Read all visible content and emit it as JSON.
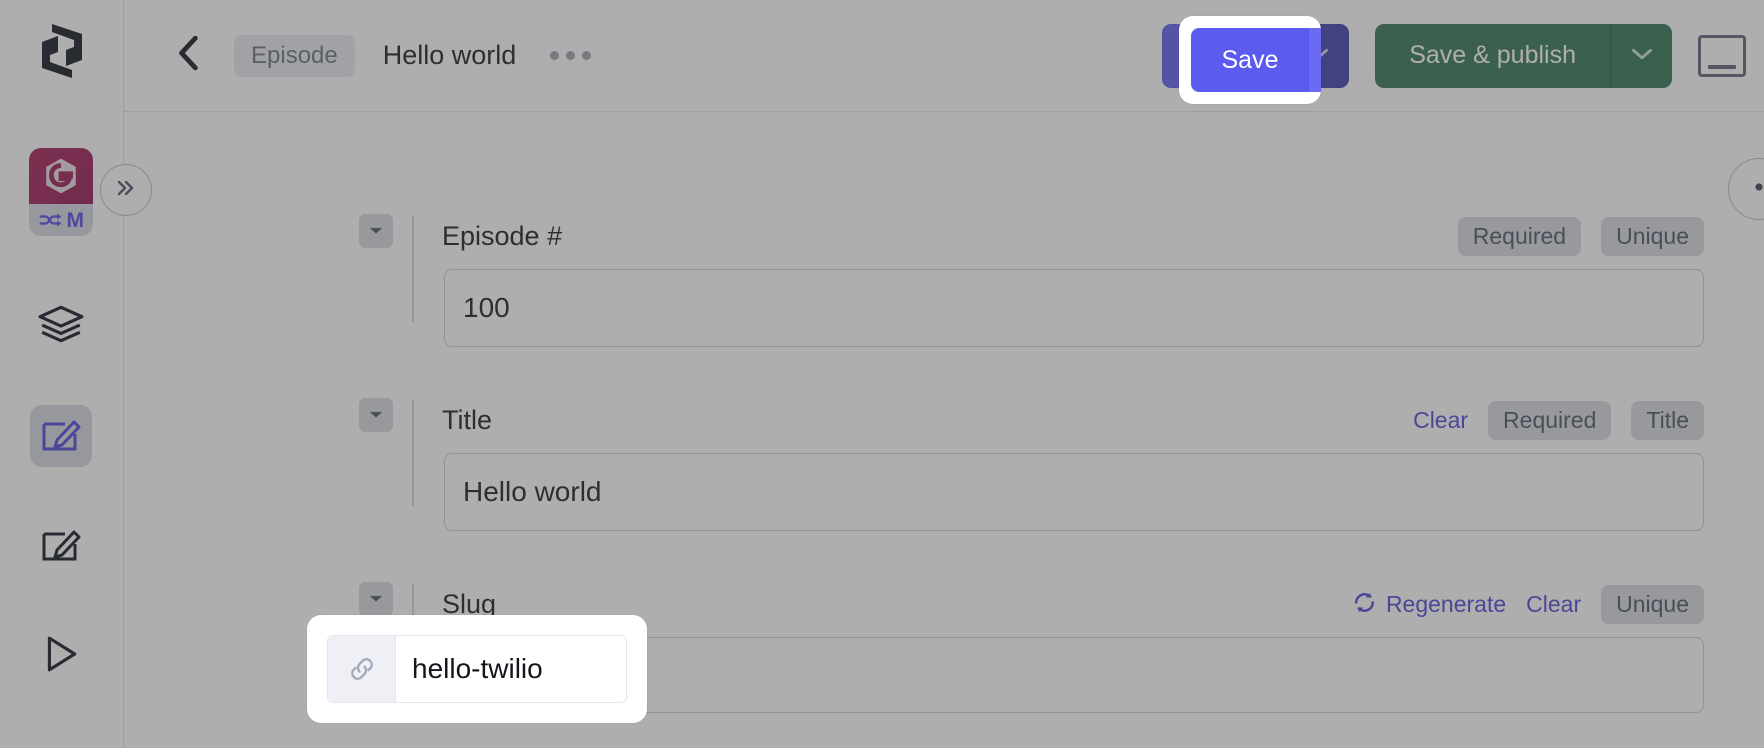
{
  "sidebar": {
    "logo_icon": "sanity-logo-icon",
    "project_badge": {
      "logo_icon": "g-hexagon-logo-icon",
      "sync_icon": "sync-arrows-icon",
      "label": "M"
    },
    "collapse_icon": "double-chevron-right-icon",
    "items": [
      {
        "name": "structure",
        "icon": "layers-icon",
        "active": false
      },
      {
        "name": "edit-primary",
        "icon": "pencil-square-icon",
        "active": true
      },
      {
        "name": "edit-secondary",
        "icon": "pencil-square-outline-icon",
        "active": false
      },
      {
        "name": "play",
        "icon": "play-triangle-icon",
        "active": false
      }
    ]
  },
  "header": {
    "back_icon": "chevron-left-icon",
    "breadcrumb_type": "Episode",
    "document_title": "Hello world",
    "overflow_icon": "ellipsis-horizontal-icon",
    "save_label": "Save",
    "save_caret_icon": "chevron-down-icon",
    "publish_label": "Save & publish",
    "publish_caret_icon": "chevron-down-icon",
    "panel_icon": "panel-bottom-icon"
  },
  "edge": {
    "round_icon": "circle-button-icon"
  },
  "fields": [
    {
      "toggle_icon": "caret-down-icon",
      "label": "Episode #",
      "actions": [
        {
          "kind": "chip",
          "label": "Required"
        },
        {
          "kind": "chip",
          "label": "Unique"
        }
      ],
      "value": "100"
    },
    {
      "toggle_icon": "caret-down-icon",
      "label": "Title",
      "actions": [
        {
          "kind": "link",
          "label": "Clear"
        },
        {
          "kind": "chip",
          "label": "Required"
        },
        {
          "kind": "chip",
          "label": "Title"
        }
      ],
      "value": "Hello world"
    },
    {
      "toggle_icon": "caret-down-icon",
      "label": "Slug",
      "actions": [
        {
          "kind": "link",
          "label": "Regenerate",
          "icon": "refresh-circle-icon"
        },
        {
          "kind": "link",
          "label": "Clear"
        },
        {
          "kind": "chip",
          "label": "Unique"
        }
      ],
      "value": ""
    }
  ],
  "highlights": {
    "save_button": {
      "label": "Save"
    },
    "slug_input": {
      "icon": "link-chain-icon",
      "value": "hello-twilio"
    }
  },
  "colors": {
    "accent_primary": "#5b5bf0",
    "accent_primary_dark": "#3b3bac",
    "publish_green": "#2f7350",
    "link": "#4b44d8",
    "chip_bg": "#d7d9e1",
    "brand_magenta": "#9c1452"
  }
}
